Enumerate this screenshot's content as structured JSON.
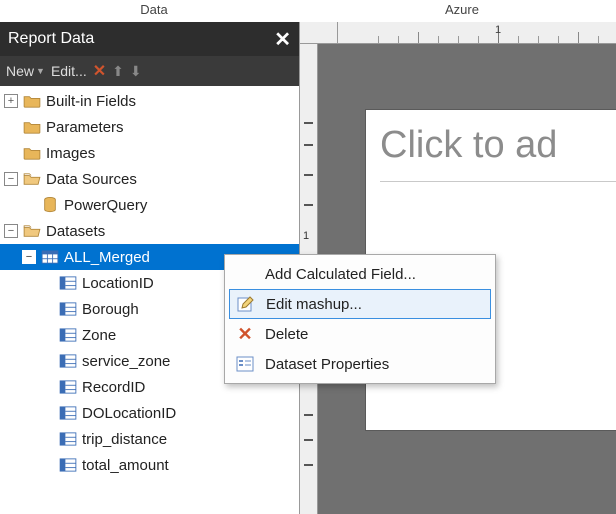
{
  "menubar": {
    "left": "Data",
    "right": "Azure"
  },
  "panel": {
    "title": "Report Data",
    "toolbar": {
      "new": "New",
      "edit": "Edit..."
    }
  },
  "tree": {
    "builtin": "Built-in Fields",
    "parameters": "Parameters",
    "images": "Images",
    "datasources": "Data Sources",
    "powerquery": "PowerQuery",
    "datasets": "Datasets",
    "all_merged": "ALL_Merged",
    "fields": [
      "LocationID",
      "Borough",
      "Zone",
      "service_zone",
      "RecordID",
      "DOLocationID",
      "trip_distance",
      "total_amount"
    ]
  },
  "ruler": {
    "label1": "1",
    "vlabel1": "1"
  },
  "page": {
    "placeholder": "Click to ad"
  },
  "context": {
    "addcalc": "Add Calculated Field...",
    "editmashup": "Edit mashup...",
    "delete": "Delete",
    "props": "Dataset Properties"
  }
}
